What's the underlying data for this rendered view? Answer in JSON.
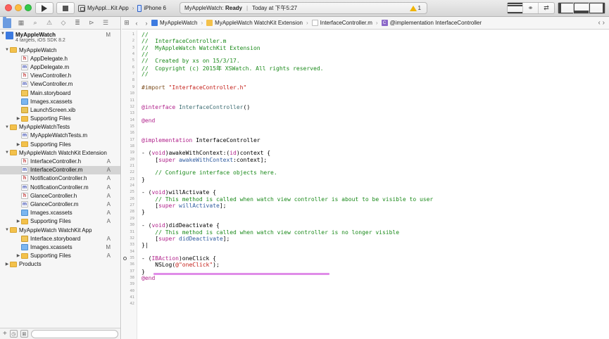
{
  "toolbar": {
    "scheme_app": "MyAppl...Kit App",
    "scheme_device": "iPhone 6",
    "status_project": "MyAppleWatch:",
    "status_state": "Ready",
    "status_time": "Today at 下午5:27",
    "warnings": "1"
  },
  "navigator": {
    "project_name": "MyAppleWatch",
    "project_sub": "4 targets, iOS SDK 8.2",
    "project_flag": "M",
    "rows": [
      {
        "label": "MyAppleWatch",
        "kind": "folder",
        "indent": 1,
        "open": true,
        "flag": ""
      },
      {
        "label": "AppDelegate.h",
        "kind": "h",
        "indent": 2,
        "flag": ""
      },
      {
        "label": "AppDelegate.m",
        "kind": "m",
        "indent": 2,
        "flag": ""
      },
      {
        "label": "ViewController.h",
        "kind": "h",
        "indent": 2,
        "flag": ""
      },
      {
        "label": "ViewController.m",
        "kind": "m",
        "indent": 2,
        "flag": ""
      },
      {
        "label": "Main.storyboard",
        "kind": "sb",
        "indent": 2,
        "flag": ""
      },
      {
        "label": "Images.xcassets",
        "kind": "xc",
        "indent": 2,
        "flag": ""
      },
      {
        "label": "LaunchScreen.xib",
        "kind": "xib",
        "indent": 2,
        "flag": ""
      },
      {
        "label": "Supporting Files",
        "kind": "folder",
        "indent": 2,
        "open": false,
        "flag": ""
      },
      {
        "label": "MyAppleWatchTests",
        "kind": "folder",
        "indent": 1,
        "open": true,
        "flag": ""
      },
      {
        "label": "MyAppleWatchTests.m",
        "kind": "m",
        "indent": 2,
        "flag": ""
      },
      {
        "label": "Supporting Files",
        "kind": "folder",
        "indent": 2,
        "open": false,
        "flag": ""
      },
      {
        "label": "MyAppleWatch WatchKit Extension",
        "kind": "folder",
        "indent": 1,
        "open": true,
        "flag": ""
      },
      {
        "label": "InterfaceController.h",
        "kind": "h",
        "indent": 2,
        "flag": "A"
      },
      {
        "label": "InterfaceController.m",
        "kind": "m",
        "indent": 2,
        "flag": "A",
        "selected": true
      },
      {
        "label": "NotificationController.h",
        "kind": "h",
        "indent": 2,
        "flag": "A"
      },
      {
        "label": "NotificationController.m",
        "kind": "m",
        "indent": 2,
        "flag": "A"
      },
      {
        "label": "GlanceController.h",
        "kind": "h",
        "indent": 2,
        "flag": "A"
      },
      {
        "label": "GlanceController.m",
        "kind": "m",
        "indent": 2,
        "flag": "A"
      },
      {
        "label": "Images.xcassets",
        "kind": "xc",
        "indent": 2,
        "flag": "A"
      },
      {
        "label": "Supporting Files",
        "kind": "folder",
        "indent": 2,
        "open": false,
        "flag": "A"
      },
      {
        "label": "MyAppleWatch WatchKit App",
        "kind": "folder",
        "indent": 1,
        "open": true,
        "flag": ""
      },
      {
        "label": "Interface.storyboard",
        "kind": "sb",
        "indent": 2,
        "flag": "A"
      },
      {
        "label": "Images.xcassets",
        "kind": "xc",
        "indent": 2,
        "flag": "M"
      },
      {
        "label": "Supporting Files",
        "kind": "folder",
        "indent": 2,
        "open": false,
        "flag": "A"
      },
      {
        "label": "Products",
        "kind": "folder",
        "indent": 1,
        "open": false,
        "flag": ""
      }
    ]
  },
  "jumpbar": {
    "crumbs": [
      "MyAppleWatch",
      "MyAppleWatch WatchKit Extension",
      "InterfaceController.m",
      "@implementation InterfaceController"
    ]
  },
  "editor": {
    "lines": [
      [
        {
          "t": "//",
          "c": "com"
        }
      ],
      [
        {
          "t": "//  InterfaceController.m",
          "c": "com"
        }
      ],
      [
        {
          "t": "//  MyAppleWatch WatchKit Extension",
          "c": "com"
        }
      ],
      [
        {
          "t": "//",
          "c": "com"
        }
      ],
      [
        {
          "t": "//  Created by xs on 15/3/17.",
          "c": "com"
        }
      ],
      [
        {
          "t": "//  Copyright (c) 2015年 XSWatch. All rights reserved.",
          "c": "com"
        }
      ],
      [
        {
          "t": "//",
          "c": "com"
        }
      ],
      [],
      [
        {
          "t": "#import ",
          "c": "pre"
        },
        {
          "t": "\"InterfaceController.h\"",
          "c": "str"
        }
      ],
      [],
      [],
      [
        {
          "t": "@interface ",
          "c": "kw"
        },
        {
          "t": "InterfaceController",
          "c": "cls"
        },
        {
          "t": "()",
          "c": ""
        }
      ],
      [],
      [
        {
          "t": "@end",
          "c": "kw"
        }
      ],
      [],
      [],
      [
        {
          "t": "@implementation ",
          "c": "kw"
        },
        {
          "t": "InterfaceController",
          "c": ""
        }
      ],
      [],
      [
        {
          "t": "- (",
          "c": ""
        },
        {
          "t": "void",
          "c": "kw"
        },
        {
          "t": ")awakeWithContext:(",
          "c": ""
        },
        {
          "t": "id",
          "c": "kw"
        },
        {
          "t": ")context {",
          "c": ""
        }
      ],
      [
        {
          "t": "    [",
          "c": ""
        },
        {
          "t": "super",
          "c": "kw"
        },
        {
          "t": " ",
          "c": ""
        },
        {
          "t": "awakeWithContext",
          "c": "meth"
        },
        {
          "t": ":context];",
          "c": ""
        }
      ],
      [],
      [
        {
          "t": "    // Configure interface objects here.",
          "c": "com"
        }
      ],
      [
        {
          "t": "}",
          "c": ""
        }
      ],
      [],
      [
        {
          "t": "- (",
          "c": ""
        },
        {
          "t": "void",
          "c": "kw"
        },
        {
          "t": ")willActivate {",
          "c": ""
        }
      ],
      [
        {
          "t": "    // This method is called when watch view controller is about to be visible to user",
          "c": "com"
        }
      ],
      [
        {
          "t": "    [",
          "c": ""
        },
        {
          "t": "super",
          "c": "kw"
        },
        {
          "t": " ",
          "c": ""
        },
        {
          "t": "willActivate",
          "c": "meth"
        },
        {
          "t": "];",
          "c": ""
        }
      ],
      [
        {
          "t": "}",
          "c": ""
        }
      ],
      [],
      [
        {
          "t": "- (",
          "c": ""
        },
        {
          "t": "void",
          "c": "kw"
        },
        {
          "t": ")didDeactivate {",
          "c": ""
        }
      ],
      [
        {
          "t": "    // This method is called when watch view controller is no longer visible",
          "c": "com"
        }
      ],
      [
        {
          "t": "    [",
          "c": ""
        },
        {
          "t": "super",
          "c": "kw"
        },
        {
          "t": " ",
          "c": ""
        },
        {
          "t": "didDeactivate",
          "c": "meth"
        },
        {
          "t": "];",
          "c": ""
        }
      ],
      [
        {
          "t": "}|",
          "c": ""
        }
      ],
      [],
      [
        {
          "t": "- (",
          "c": ""
        },
        {
          "t": "IBAction",
          "c": "kw"
        },
        {
          "t": ")oneClick {",
          "c": ""
        }
      ],
      [
        {
          "t": "    NSLog(",
          "c": ""
        },
        {
          "t": "@\"oneClick\"",
          "c": "str"
        },
        {
          "t": ");",
          "c": ""
        }
      ],
      [
        {
          "t": "}",
          "c": ""
        }
      ],
      [
        {
          "t": "@end",
          "c": "kw"
        }
      ],
      [],
      [],
      [],
      []
    ],
    "ib_line": 35
  }
}
